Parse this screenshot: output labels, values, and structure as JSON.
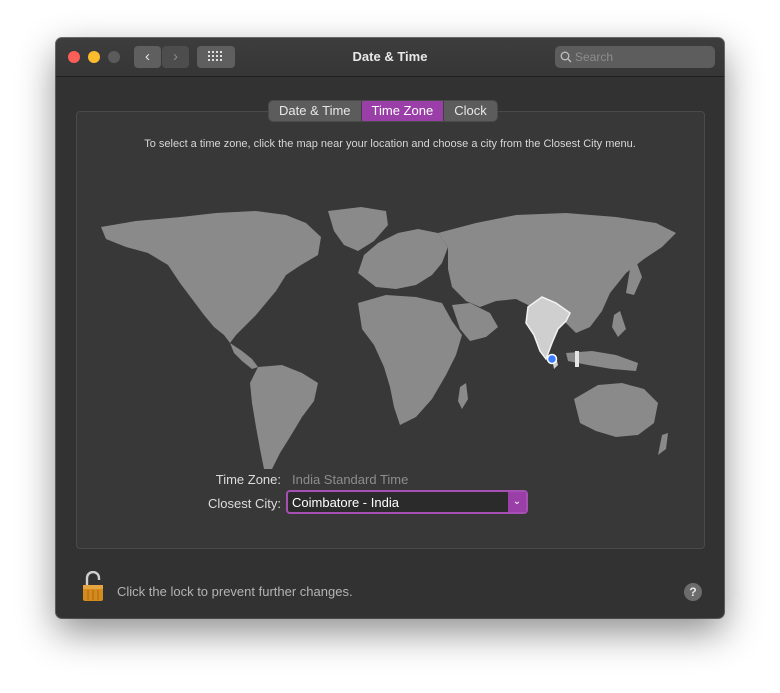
{
  "window": {
    "title": "Date & Time"
  },
  "toolbar": {
    "back_icon": "chevron-left-icon",
    "forward_icon": "chevron-right-icon",
    "grid_icon": "show-all-grid-icon",
    "search_placeholder": "Search"
  },
  "tabs": [
    {
      "label": "Date & Time",
      "active": false
    },
    {
      "label": "Time Zone",
      "active": true
    },
    {
      "label": "Clock",
      "active": false
    }
  ],
  "instruction": "To select a time zone, click the map near your location and choose a city from the Closest City menu.",
  "map": {
    "highlighted_region": "India",
    "pin": "Coimbatore"
  },
  "form": {
    "time_zone_label": "Time Zone:",
    "time_zone_value": "India Standard Time",
    "closest_city_label": "Closest City:",
    "closest_city_value": "Coimbatore - India"
  },
  "footer": {
    "lock_text": "Click the lock to prevent further changes.",
    "help_label": "?"
  },
  "colors": {
    "accent": "#9b3fa8",
    "background": "#323232",
    "land": "#8a8a8a"
  }
}
